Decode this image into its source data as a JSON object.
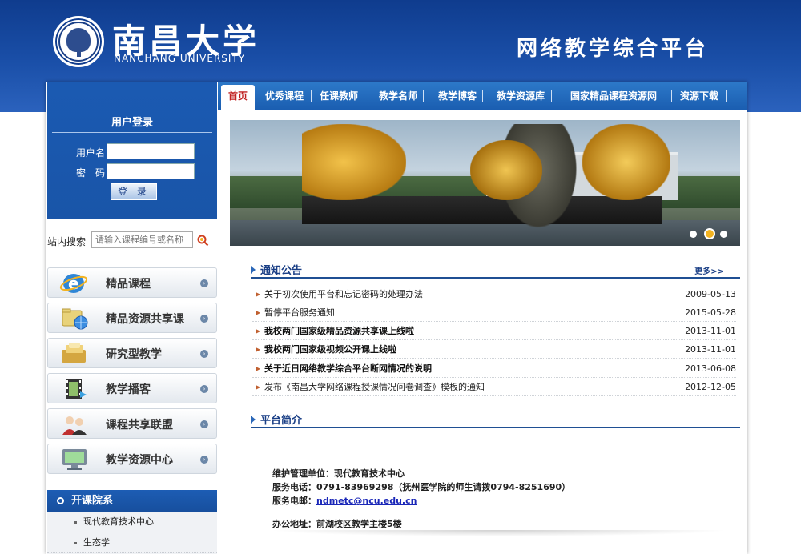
{
  "header": {
    "school_name": "南昌大学",
    "school_name_en": "NANCHANG UNIVERSITY",
    "platform_title": "网络教学综合平台"
  },
  "nav": {
    "items": [
      "首页",
      "优秀课程",
      "任课教师",
      "教学名师",
      "教学博客",
      "教学资源库",
      "国家精品课程资源网",
      "资源下载"
    ],
    "active_index": 0
  },
  "login": {
    "title": "用户登录",
    "username_label": "用户名",
    "password_label": "密　码",
    "button_label": "登 录"
  },
  "search": {
    "label": "站内搜索",
    "placeholder": "请输入课程编号或名称",
    "icon": "search-icon"
  },
  "left_menu": [
    {
      "label": "精品课程",
      "icon": "ie-icon"
    },
    {
      "label": "精品资源共享课",
      "icon": "folder-globe-icon"
    },
    {
      "label": "研究型教学",
      "icon": "books-icon"
    },
    {
      "label": "教学播客",
      "icon": "film-icon"
    },
    {
      "label": "课程共享联盟",
      "icon": "users-icon"
    },
    {
      "label": "教学资源中心",
      "icon": "monitor-icon"
    }
  ],
  "colleges": {
    "title": "开课院系",
    "items": [
      "现代教育技术中心",
      "生态学"
    ]
  },
  "banner": {
    "slides": 3,
    "active_slide": 1
  },
  "notices": {
    "title": "通知公告",
    "more_label": "更多>>",
    "items": [
      {
        "title": "关于初次使用平台和忘记密码的处理办法",
        "date": "2009-05-13",
        "bold": false
      },
      {
        "title": "暂停平台服务通知",
        "date": "2015-05-28",
        "bold": false
      },
      {
        "title": "我校两门国家级精品资源共享课上线啦",
        "date": "2013-11-01",
        "bold": true
      },
      {
        "title": "我校两门国家级视频公开课上线啦",
        "date": "2013-11-01",
        "bold": true
      },
      {
        "title": "关于近日网络教学综合平台断网情况的说明",
        "date": "2013-06-08",
        "bold": true
      },
      {
        "title": "发布《南昌大学网络课程授课情况问卷调查》模板的通知",
        "date": "2012-12-05",
        "bold": false
      }
    ]
  },
  "intro": {
    "title": "平台简介",
    "maintainer": "维护管理单位：现代教育技术中心",
    "phone": "服务电话：0791-83969298（抚州医学院的师生请拨0794-8251690）",
    "email_label": "服务电邮：",
    "email": "ndmetc@ncu.edu.cn",
    "address": "办公地址：前湖校区教学主楼5楼"
  },
  "colors": {
    "header_blue": "#1a4fa8",
    "nav_blue": "#2d79c9",
    "active_nav_text": "#c02020",
    "section_title": "#1a3f86"
  }
}
